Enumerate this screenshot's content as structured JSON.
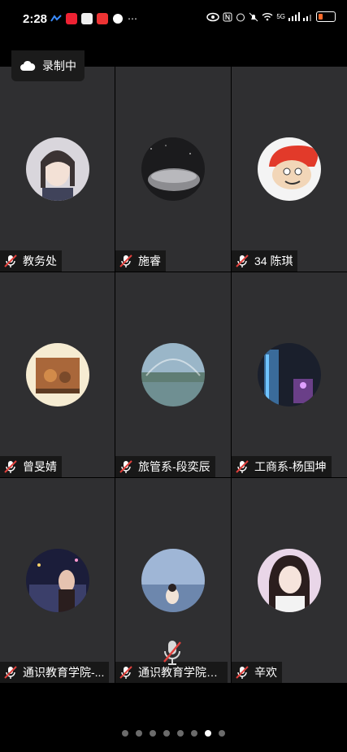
{
  "status_bar": {
    "time": "2:28",
    "battery_level": 0.3,
    "signal_label": "5G"
  },
  "recording": {
    "label": "录制中"
  },
  "participants": [
    {
      "name": "教务处"
    },
    {
      "name": "施睿"
    },
    {
      "name": "34 陈琪"
    },
    {
      "name": "曾旻婧"
    },
    {
      "name": "旅管系-段奕辰"
    },
    {
      "name": "工商系-杨国坤"
    },
    {
      "name": "通识教育学院-..."
    },
    {
      "name": "通识教育学院向..."
    },
    {
      "name": "辛欢"
    }
  ],
  "pager": {
    "total": 8,
    "active": 7
  },
  "colors": {
    "tile_bg": "#2f2f31",
    "muted_red": "#e0403c",
    "accent": "#ff6a2a"
  }
}
